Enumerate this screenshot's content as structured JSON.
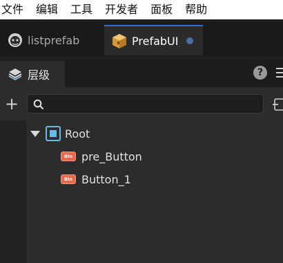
{
  "menu": [
    "文件",
    "编辑",
    "工具",
    "开发者",
    "面板",
    "帮助"
  ],
  "tabs": [
    {
      "label": "listprefab",
      "icon": "monkey-icon",
      "active": false
    },
    {
      "label": "PrefabUI",
      "icon": "prefab-box-icon",
      "active": true,
      "unsaved": true
    }
  ],
  "panel": {
    "title": "层级",
    "search_placeholder": "",
    "search_value": ""
  },
  "tree": {
    "root": {
      "label": "Root",
      "expanded": true
    },
    "children": [
      {
        "label": "pre_Button",
        "badge": "Btn"
      },
      {
        "label": "Button_1",
        "badge": "Btn"
      }
    ]
  },
  "colors": {
    "accent": "#2e6fd6",
    "badge": "#e86a4c",
    "unsaved_dot": "#4d6fa8"
  }
}
